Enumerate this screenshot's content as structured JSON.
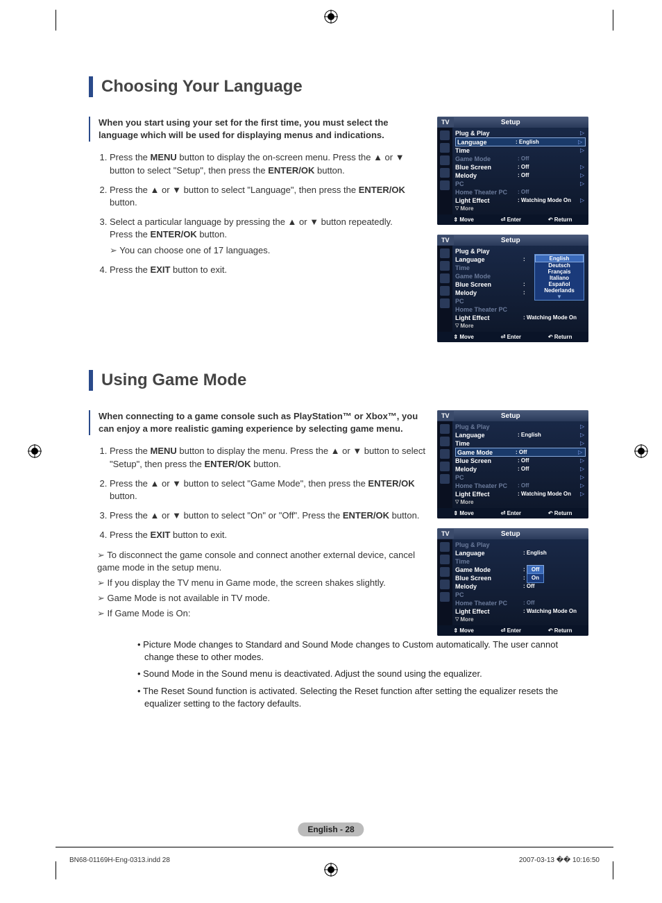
{
  "section1": {
    "title": "Choosing Your Language",
    "intro": "When you start using your set for the first time, you must select the language which will be used for displaying menus and indications.",
    "steps": {
      "s1a": "Press the ",
      "s1b": "MENU",
      "s1c": " button to display the on-screen menu. Press the ▲ or ▼ button to select \"Setup\", then press the ",
      "s1d": "ENTER/OK",
      "s1e": " button.",
      "s2a": "Press the ▲ or ▼ button to select \"Language\", then press the ",
      "s2b": "ENTER/OK",
      "s2c": " button.",
      "s3a": "Select a particular language by pressing the ▲ or ▼ button repeatedly.",
      "s3b": "Press the ",
      "s3c": "ENTER/OK",
      "s3d": " button.",
      "s3note": "You can choose one of 17 languages.",
      "s4a": "Press the ",
      "s4b": "EXIT",
      "s4c": " button to exit."
    }
  },
  "section2": {
    "title": "Using Game Mode",
    "intro": "When connecting to a game console such as PlayStation™ or Xbox™, you can enjoy a more realistic gaming experience by selecting game menu.",
    "steps": {
      "s1a": "Press the ",
      "s1b": "MENU",
      "s1c": " button to display the menu. Press the ▲ or ▼ button to select \"Setup\", then press the ",
      "s1d": "ENTER/OK",
      "s1e": " button.",
      "s2a": "Press the ▲ or ▼ button to select \"Game Mode\", then press the ",
      "s2b": "ENTER/OK",
      "s2c": " button.",
      "s3a": "Press the ▲ or ▼ button to select \"On\" or \"Off\". Press the ",
      "s3b": "ENTER/OK",
      "s3c": " button.",
      "s4a": "Press the ",
      "s4b": "EXIT",
      "s4c": " button to exit.",
      "n1": "To disconnect the game console and connect another external device, cancel game mode in the setup menu.",
      "n2": "If you display the TV menu in Game mode, the screen shakes slightly.",
      "n3": "Game Mode is not available in TV mode.",
      "n4": "If Game Mode is On:",
      "b1": "Picture Mode changes to Standard and Sound Mode changes to Custom automatically. The user cannot change these to other modes.",
      "b2": "Sound Mode in the Sound menu is deactivated. Adjust the sound using the equalizer.",
      "b3": "The Reset Sound function is activated. Selecting the Reset function after setting the equalizer resets the equalizer setting to the factory defaults."
    }
  },
  "osd": {
    "tv": "TV",
    "setup": "Setup",
    "plugplay": "Plug & Play",
    "language": "Language",
    "time": "Time",
    "gamemode": "Game Mode",
    "bluescreen": "Blue Screen",
    "melody": "Melody",
    "pc": "PC",
    "hometheater": "Home Theater PC",
    "lighteffect": "Light Effect",
    "more": "More",
    "english": ": English",
    "english2": ":  English",
    "off": ": Off",
    "watching": ": Watching Mode On",
    "move": "Move",
    "enter": "Enter",
    "return": "Return",
    "langs": {
      "english": "English",
      "deutsch": "Deutsch",
      "francais": "Français",
      "italiano": "Italiano",
      "espanol": "Español",
      "nederlands": "Nederlands"
    },
    "offopt": "Off",
    "onopt": "On"
  },
  "footer": {
    "pagenum": "English - 28",
    "left": "BN68-01169H-Eng-0313.indd   28",
    "right": "2007-03-13   �� 10:16:50"
  }
}
